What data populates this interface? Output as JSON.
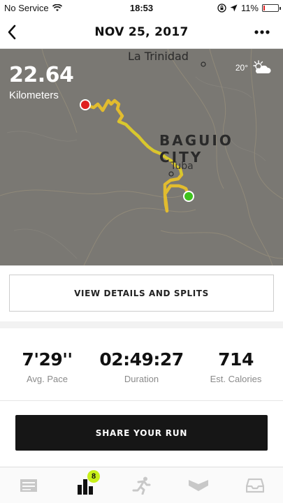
{
  "status_bar": {
    "carrier": "No Service",
    "time": "18:53",
    "battery": "11%",
    "battery_level": 0.11
  },
  "header": {
    "title": "NOV 25, 2017"
  },
  "map": {
    "distance_value": "22.64",
    "distance_unit": "Kilometers",
    "temperature": "20°",
    "weather_icon": "partly-cloudy-icon",
    "places": {
      "trinidad": "La Trinidad",
      "baguio": "BAGUIO CITY",
      "tuba": "Tuba"
    },
    "route_color": "#e8c02a",
    "start_color": "#3ec21e",
    "end_color": "#e02020"
  },
  "details_button": {
    "label": "VIEW DETAILS AND SPLITS"
  },
  "stats": {
    "pace": {
      "value": "7'29''",
      "label": "Avg. Pace"
    },
    "duration": {
      "value": "02:49:27",
      "label": "Duration"
    },
    "calories": {
      "value": "714",
      "label": "Est. Calories"
    }
  },
  "share_button": {
    "label": "SHARE YOUR RUN"
  },
  "tabbar": {
    "tabs": [
      {
        "name": "feed-icon"
      },
      {
        "name": "activity-icon",
        "badge": "8"
      },
      {
        "name": "run-icon"
      },
      {
        "name": "club-icon"
      },
      {
        "name": "inbox-icon"
      }
    ],
    "badge_color": "#c8f01a"
  }
}
